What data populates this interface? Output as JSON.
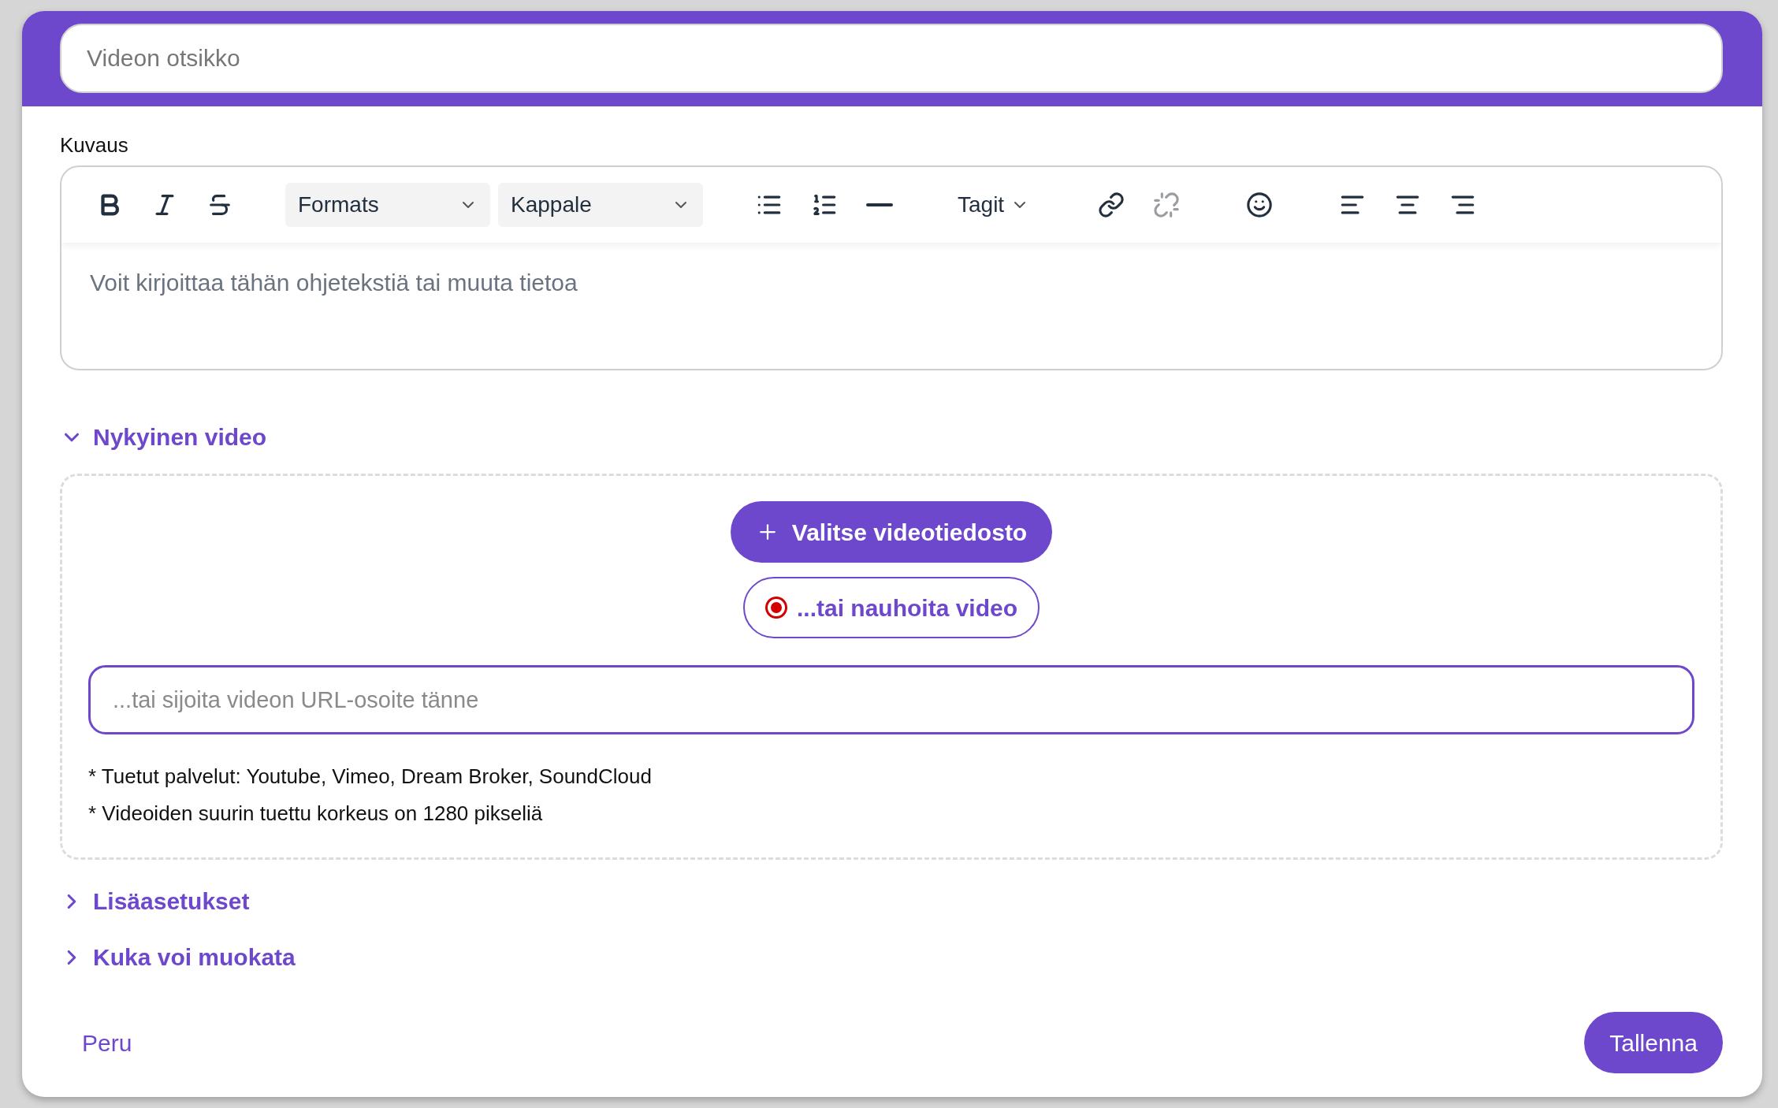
{
  "title_field": {
    "placeholder": "Videon otsikko"
  },
  "description": {
    "label": "Kuvaus",
    "placeholder": "Voit kirjoittaa tähän ohjetekstiä tai muuta tietoa",
    "toolbar": [
      {
        "kind": "bold",
        "disabled": false
      },
      {
        "kind": "italic",
        "disabled": false
      },
      {
        "kind": "strikethrough",
        "disabled": false
      },
      {
        "kind": "select",
        "label": "Formats"
      },
      {
        "kind": "select",
        "label": "Kappale"
      },
      {
        "kind": "bullet-list",
        "disabled": false
      },
      {
        "kind": "numbered-list",
        "disabled": false
      },
      {
        "kind": "horizontal-rule",
        "disabled": false
      },
      {
        "kind": "menu",
        "label": "Tagit"
      },
      {
        "kind": "link",
        "disabled": false
      },
      {
        "kind": "unlink",
        "disabled": true
      },
      {
        "kind": "emoji",
        "disabled": false
      },
      {
        "kind": "align-left",
        "disabled": false
      },
      {
        "kind": "align-center",
        "disabled": false
      },
      {
        "kind": "align-right",
        "disabled": false
      }
    ]
  },
  "sections": [
    {
      "label": "Nykyinen video",
      "expanded": true,
      "content": {
        "upload_button": "Valitse videotiedosto",
        "record_button": "...tai nauhoita video",
        "url_field": {
          "placeholder": "...tai sijoita videon URL-osoite tänne"
        },
        "notes": [
          "* Tuetut palvelut: Youtube, Vimeo, Dream Broker, SoundCloud",
          "* Videoiden suurin tuettu korkeus on 1280 pikseliä"
        ]
      }
    },
    {
      "label": "Lisäasetukset",
      "expanded": false
    },
    {
      "label": "Kuka voi muokata",
      "expanded": false
    }
  ],
  "footer": {
    "cancel": "Peru",
    "save": "Tallenna"
  }
}
